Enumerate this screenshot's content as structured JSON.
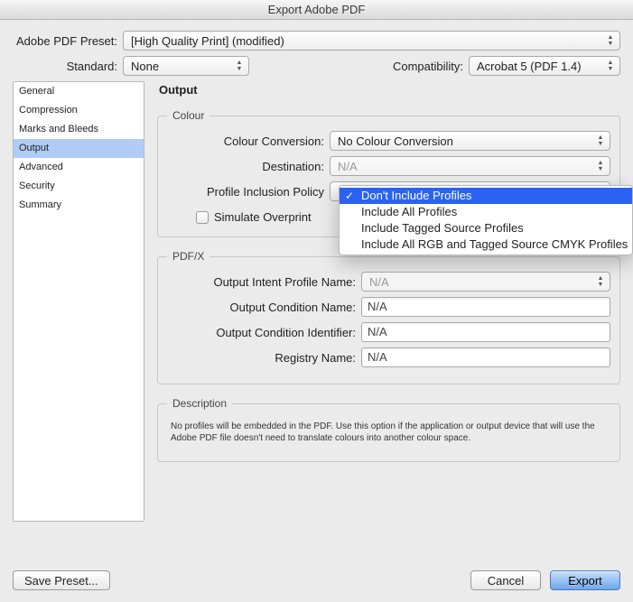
{
  "window_title": "Export Adobe PDF",
  "top": {
    "preset_label": "Adobe PDF Preset:",
    "preset_value": "[High Quality Print] (modified)",
    "standard_label": "Standard:",
    "standard_value": "None",
    "compat_label": "Compatibility:",
    "compat_value": "Acrobat 5 (PDF 1.4)"
  },
  "sidebar": {
    "items": [
      {
        "label": "General"
      },
      {
        "label": "Compression"
      },
      {
        "label": "Marks and Bleeds"
      },
      {
        "label": "Output"
      },
      {
        "label": "Advanced"
      },
      {
        "label": "Security"
      },
      {
        "label": "Summary"
      }
    ],
    "selected_index": 3
  },
  "panel": {
    "title": "Output",
    "colour": {
      "legend": "Colour",
      "conversion_label": "Colour Conversion:",
      "conversion_value": "No Colour Conversion",
      "destination_label": "Destination:",
      "destination_value": "N/A",
      "policy_label": "Profile Inclusion Policy",
      "simulate_label": "Simulate Overprint"
    },
    "pdfx": {
      "legend": "PDF/X",
      "intent_label": "Output Intent Profile Name:",
      "intent_value": "N/A",
      "cond_name_label": "Output Condition Name:",
      "cond_name_value": "N/A",
      "cond_id_label": "Output Condition Identifier:",
      "cond_id_value": "N/A",
      "registry_label": "Registry Name:",
      "registry_value": "N/A"
    },
    "description": {
      "legend": "Description",
      "text": "No profiles will be embedded in the PDF. Use this option if the application or output device that will use the Adobe PDF file doesn't need to translate colours into another colour space."
    }
  },
  "popup": {
    "items": [
      "Don't Include Profiles",
      "Include All Profiles",
      "Include Tagged Source Profiles",
      "Include All RGB and Tagged Source CMYK Profiles"
    ],
    "selected_index": 0
  },
  "footer": {
    "save_preset": "Save Preset...",
    "cancel": "Cancel",
    "export": "Export"
  }
}
